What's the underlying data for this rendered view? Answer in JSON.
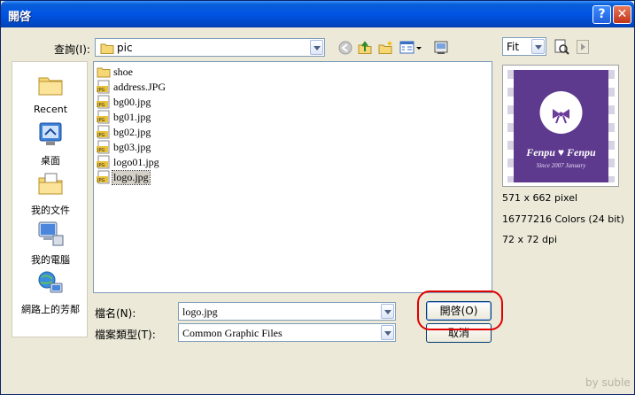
{
  "window": {
    "title": "開啓"
  },
  "titlebar": {
    "help_glyph": "?",
    "close_glyph": "✕"
  },
  "lookin": {
    "label": "查詢(I):",
    "value": "pic"
  },
  "places": [
    {
      "label": "Recent",
      "icon": "recent-folder-icon"
    },
    {
      "label": "桌面",
      "icon": "desktop-icon"
    },
    {
      "label": "我的文件",
      "icon": "my-documents-icon"
    },
    {
      "label": "我的電腦",
      "icon": "my-computer-icon"
    },
    {
      "label": "網路上的芳鄰",
      "icon": "network-places-icon"
    }
  ],
  "files": [
    {
      "name": "shoe",
      "type": "folder"
    },
    {
      "name": "address.JPG",
      "type": "jpg"
    },
    {
      "name": "bg00.jpg",
      "type": "jpg"
    },
    {
      "name": "bg01.jpg",
      "type": "jpg"
    },
    {
      "name": "bg02.jpg",
      "type": "jpg"
    },
    {
      "name": "bg03.jpg",
      "type": "jpg"
    },
    {
      "name": "logo01.jpg",
      "type": "jpg"
    },
    {
      "name": "logo.jpg",
      "type": "jpg",
      "selected": true
    }
  ],
  "filename": {
    "label": "檔名(N):",
    "value": "logo.jpg"
  },
  "filetype": {
    "label": "檔案類型(T):",
    "value": "Common Graphic Files"
  },
  "buttons": {
    "open": "開啓(O)",
    "cancel": "取消"
  },
  "preview": {
    "zoom": "Fit",
    "brand": "Fenpu ♥ Fenpu",
    "tagline": "Since 2007 January",
    "size": "571 x 662 pixel",
    "colors": "16777216 Colors (24 bit)",
    "dpi": "72 x 72 dpi"
  },
  "watermark": "by suble",
  "colors": {
    "titlebar": "#0054e3",
    "dialog_bg": "#ece9d8",
    "preview_bg": "#5e3a8e",
    "highlight": "#e00000"
  }
}
